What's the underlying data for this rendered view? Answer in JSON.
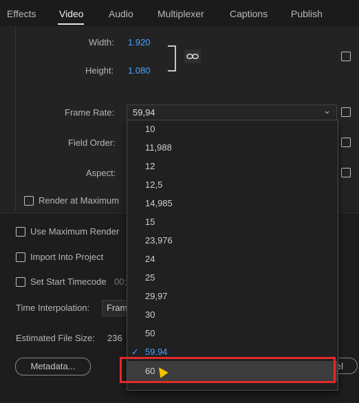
{
  "tabs": [
    {
      "label": "Effects"
    },
    {
      "label": "Video"
    },
    {
      "label": "Audio"
    },
    {
      "label": "Multiplexer"
    },
    {
      "label": "Captions"
    },
    {
      "label": "Publish"
    }
  ],
  "video": {
    "width_label": "Width:",
    "width_value": "1.920",
    "height_label": "Height:",
    "height_value": "1.080",
    "frame_rate_label": "Frame Rate:",
    "frame_rate_value": "59,94",
    "field_order_label": "Field Order:",
    "aspect_label": "Aspect:",
    "render_max_label": "Render at Maximum"
  },
  "settings": {
    "use_max_render_label": "Use Maximum Render",
    "import_label": "Import Into Project",
    "set_start_timecode_label": "Set Start Timecode",
    "timecode_value": "00;",
    "time_interp_label": "Time Interpolation:",
    "time_interp_value": "Fram",
    "file_size_label": "Estimated File Size:",
    "file_size_value": "236"
  },
  "buttons": {
    "metadata": "Metadata...",
    "right_partial": "el"
  },
  "dropdown": {
    "options": [
      "10",
      "11,988",
      "12",
      "12,5",
      "14,985",
      "15",
      "23,976",
      "24",
      "25",
      "29,97",
      "30",
      "50",
      "59.94",
      "60"
    ],
    "selected": "59.94",
    "hovered": "60"
  },
  "icons": {
    "link": "link-icon",
    "check": "checkmark-icon",
    "cursor": "mouse-cursor-icon"
  },
  "colors": {
    "accent": "#4aa3ff",
    "highlight": "#e22a2a"
  }
}
